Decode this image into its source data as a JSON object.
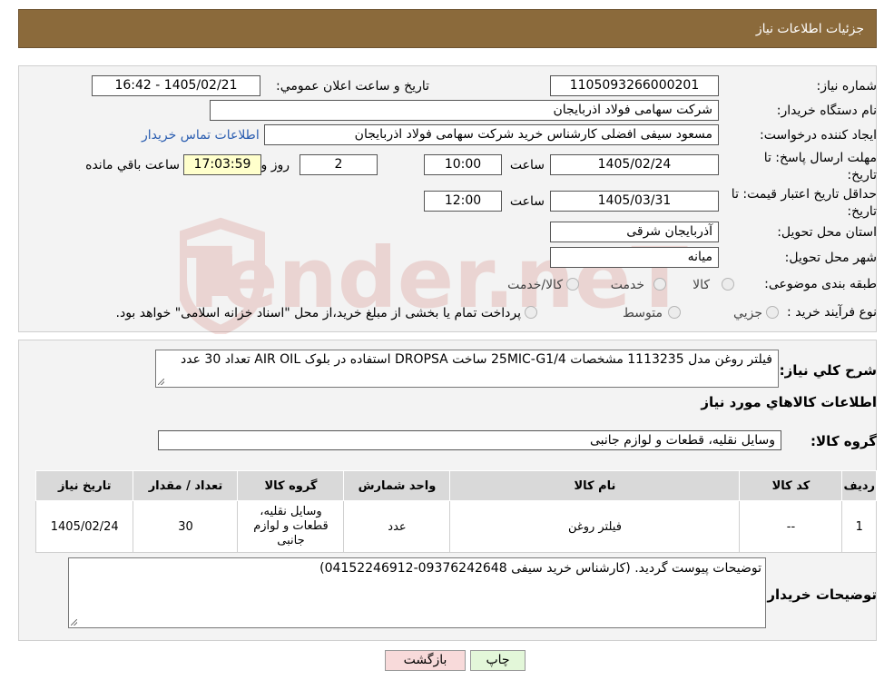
{
  "header": {
    "title": "جزئیات اطلاعات نیاز"
  },
  "watermark": {
    "text": "AriaTender.neT",
    "color": "#c0392b"
  },
  "form": {
    "need_number_label": "شماره نیاز:",
    "need_number": "1105093266000201",
    "announce_label": "تاریخ و ساعت اعلان عمومي:",
    "announce_value": "1405/02/21 - 16:42",
    "buyer_org_label": "نام دستگاه خريدار:",
    "buyer_org": "شرکت سهامی فولاد اذربایجان",
    "creator_label": "ايجاد کننده درخواست:",
    "creator": "مسعود سیفی افضلی کارشناس خرید شرکت سهامی فولاد اذربایجان",
    "contact_link": "اطلاعات تماس خريدار",
    "deadline_label_1": "مهلت ارسال پاسخ: تا",
    "deadline_label_2": "تاريخ:",
    "deadline_date": "1405/02/24",
    "time_word": "ساعت",
    "deadline_time": "10:00",
    "days": "2",
    "days_word": "روز و",
    "remaining_time": "17:03:59",
    "remaining_word": "ساعت باقي مانده",
    "validity_label_1": "حداقل تاريخ اعتبار قيمت: تا",
    "validity_label_2": "تاريخ:",
    "validity_date": "1405/03/31",
    "validity_time": "12:00",
    "province_label": "استان محل تحويل:",
    "province": "آذربایجان شرقی",
    "city_label": "شهر محل تحويل:",
    "city": "میانه",
    "category_label": "طبقه بندی موضوعی:",
    "category_options": [
      "کالا",
      "خدمت",
      "کالا/خدمت"
    ],
    "process_label": "نوع فرآيند خريد :",
    "process_options": [
      "جزيي",
      "متوسط"
    ],
    "process_note": "پرداخت تمام يا بخشی از مبلغ خريد،از محل \"اسناد خزانه اسلامی\" خواهد بود."
  },
  "description": {
    "label": "شرح کلي نياز:",
    "text": "فیلتر روغن مدل 1113235 مشخصات 25MIC-G1/4 ساخت DROPSA استفاده در بلوک AIR OIL تعداد 30 عدد"
  },
  "goods": {
    "section_title": "اطلاعات کالاهاي مورد نياز",
    "group_label": "گروه کالا:",
    "group_value": "وسایل نقلیه، قطعات و لوازم جانبی",
    "columns": [
      "رديف",
      "کد کالا",
      "نام کالا",
      "واحد شمارش",
      "گروه کالا",
      "تعداد / مقدار",
      "تاريخ نياز"
    ],
    "rows": [
      [
        "1",
        "--",
        "فیلتر روغن",
        "عدد",
        "وسایل نقلیه، قطعات و لوازم جانبی",
        "30",
        "1405/02/24"
      ]
    ]
  },
  "buyer_notes": {
    "label": "توضيحات خريدار:",
    "text": "توضیحات پیوست گردید. (کارشناس خرید سیفی 09376242648-04152246912)"
  },
  "buttons": {
    "print": "چاپ",
    "back": "بازگشت"
  },
  "colors": {
    "header_bg": "#8b6a3b",
    "panel_bg": "#f3f3f3",
    "yellow_field": "#ffffcc",
    "back_button_bg": "#f8dada",
    "print_button_bg": "#e3f7d9",
    "link": "#2a5db0"
  }
}
